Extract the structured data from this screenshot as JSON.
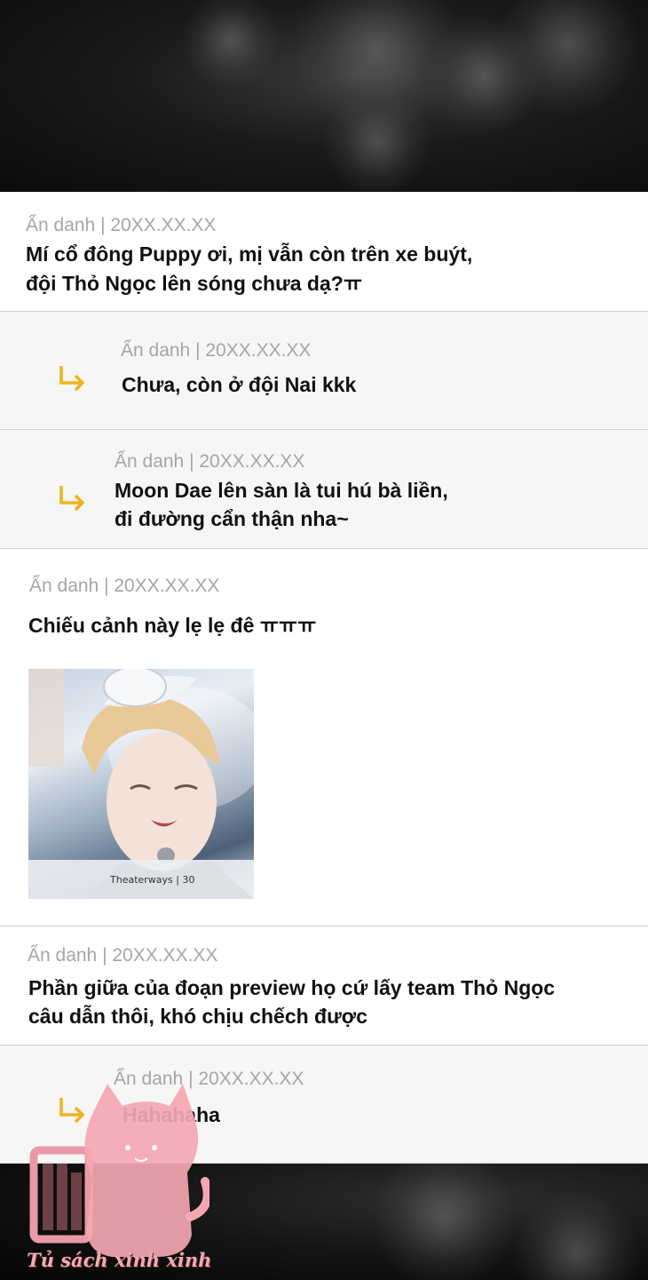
{
  "comments": [
    {
      "meta": "Ẩn danh | 20XX.XX.XX",
      "line1": "Mí cổ đông Puppy ơi, mị vẫn còn trên xe buýt,",
      "line2": "đội Thỏ Ngọc lên sóng chưa dạ?ㅠ"
    },
    {
      "meta": "Ẩn danh | 20XX.XX.XX",
      "line1": "Chưa, còn ở đội Nai kkk"
    },
    {
      "meta": "Ẩn danh | 20XX.XX.XX",
      "line1": "Moon Dae lên sàn là tui hú bà liền,",
      "line2": "đi đường cẩn thận nha~"
    },
    {
      "meta": "Ẩn danh | 20XX.XX.XX",
      "line1": "Chiếu cảnh này lẹ lẹ đê ㅠㅠㅠ",
      "image_watermark": "Theaterways | 30"
    },
    {
      "meta": "Ẩn danh | 20XX.XX.XX",
      "line1": "Phần giữa của đoạn preview họ cứ lấy team Thỏ Ngọc",
      "line2": "câu dẫn thôi, khó chịu chếch được"
    },
    {
      "meta": "Ẩn danh | 20XX.XX.XX",
      "line1": "Hahahaha"
    }
  ],
  "watermark_logo": {
    "text": "Tủ sách xinh xinh",
    "icon": "pink-cat-bookshelf-logo"
  },
  "colors": {
    "reply_arrow": "#f0b21c",
    "meta_text": "#a6a6a6",
    "reply_bg": "#f6f6f6",
    "logo_pink": "#f3a9b3"
  }
}
